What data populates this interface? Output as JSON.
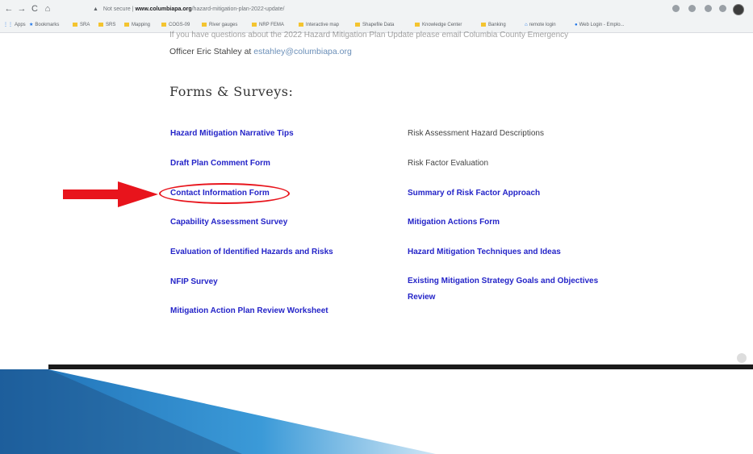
{
  "browser": {
    "nav": {
      "back": "←",
      "forward": "→",
      "reload": "C",
      "home": "⌂"
    },
    "address": {
      "security": "Not secure",
      "host": "www.columbiapa.org",
      "path": "/hazard-mitigation-plan-2022-update/"
    },
    "bookmarks": [
      "Apps",
      "Bookmarks",
      "SRA",
      "SRS",
      "Mapping",
      "COGS-09",
      "River gauges",
      "NRP FEMA",
      "Interactive map",
      "Shapefile Data",
      "Knowledge Center",
      "Banking",
      "remote login",
      "Web Login - Emplo..."
    ]
  },
  "page": {
    "intro_text": "If you have questions about the 2022 Hazard Mitigation Plan Update please email Columbia County Emergency",
    "officer_prefix": "Officer Eric Stahley at ",
    "officer_email": "estahley@columbiapa.org",
    "heading": "Forms & Surveys:",
    "left_links": [
      "Hazard Mitigation Narrative Tips",
      "Draft Plan Comment Form",
      "Contact Information Form",
      "Capability Assessment Survey",
      "Evaluation of Identified Hazards and Risks",
      "NFIP Survey",
      "Mitigation Action Plan Review Worksheet"
    ],
    "right_plain": [
      "Risk Assessment Hazard Descriptions",
      "Risk Factor Evaluation"
    ],
    "right_links": [
      "Summary of Risk Factor Approach",
      "Mitigation Actions Form",
      "Hazard Mitigation Techniques and Ideas"
    ],
    "right_wrap_link": {
      "line1": "Existing Mitigation Strategy Goals and Objectives",
      "line2": "Review"
    }
  },
  "annotation": {
    "arrow_color": "#e8141c",
    "highlight_color": "#e8141c"
  },
  "colors": {
    "link": "#2424c8",
    "slide_band_dark": "#1a1a1a",
    "slide_band_blue": "#2a7fc4"
  }
}
